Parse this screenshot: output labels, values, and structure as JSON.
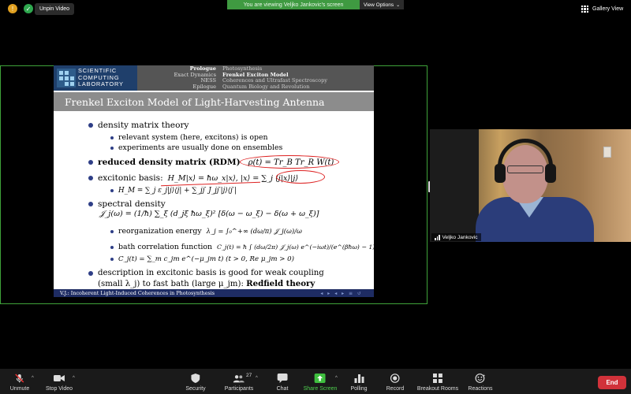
{
  "topbar": {
    "unpin_label": "Unpin Video",
    "banner_text": "You are viewing Veljko Jankovic's screen",
    "view_options_label": "View Options",
    "view_options_caret": "⌄",
    "gallery_label": "Gallery View"
  },
  "slide": {
    "logo_lines": [
      "SCIENTIFIC",
      "COMPUTING",
      "LABORATORY"
    ],
    "nav_left": [
      "Prologue",
      "Exact Dynamics",
      "NESS",
      "Epilogue"
    ],
    "nav_right": [
      "Photosynthesis",
      "Frenkel Exciton Model",
      "Coherences and Ultrafast Spectroscopy",
      "Quantum Biology and Revolution"
    ],
    "title": "Frenkel Exciton Model of Light-Harvesting Antenna",
    "b1_text": "density matrix theory",
    "b1_sub1": "relevant system (here, excitons) is open",
    "b1_sub2": "experiments are usually done on ensembles",
    "b2_bold": "reduced density matrix (RDM)",
    "b2_math": "ρ(t) = Tr_B Tr_R W(t)",
    "b3_text": "excitonic basis:",
    "b3_math": "H_M|x⟩ = ħω_x|x⟩, |x⟩ = ∑_j ⟨j|x⟩|j⟩",
    "b3_sub": "H_M = ∑_j ε_j|j⟩⟨j| + ∑_jj′ J_jj′|j⟩⟨j′|",
    "b4_text": "spectral density",
    "b4_math": "𝒥_j(ω) = (1/ħ) ∑_ξ (d_jξ ħω_ξ)² [δ(ω − ω_ξ) − δ(ω + ω_ξ)]",
    "b4_sub1_text": "reorganization energy",
    "b4_sub1_math": "λ_j = ∫₀^+∞ (dω/π) 𝒥_j(ω)/ω",
    "b4_sub2_text": "bath correlation function",
    "b4_sub2_math": "C_j(t) = ħ ∫ (dω/2π) 𝒥_j(ω) e^(−iωt)/(e^(βħω) − 1)",
    "b4_sub3_math": "C_j(t) = ∑_m c_jm e^(−μ_jm t)  (t > 0, Re μ_jm > 0)",
    "b5_line1": "description in excitonic basis is good for weak coupling",
    "b5_line2": "(small λ_j) to fast bath (large μ_jm):",
    "b5_bold": "Redfield theory",
    "footer": "V.J.: Incoherent Light-Induced Coherences in Photosynthesis"
  },
  "participant": {
    "name": "Veljko Jankovic"
  },
  "toolbar": {
    "unmute": "Unmute",
    "stop_video": "Stop Video",
    "security": "Security",
    "participants": "Participants",
    "participants_count": "27",
    "chat": "Chat",
    "share_screen": "Share Screen",
    "polling": "Polling",
    "record": "Record",
    "breakout": "Breakout Rooms",
    "reactions": "Reactions",
    "end": "End"
  },
  "colors": {
    "share_border": "#3fa33a",
    "banner_bg": "#3f9a41",
    "end_button": "#d1323a",
    "slide_footer": "#1e2c63",
    "annotation": "#dd2222"
  }
}
